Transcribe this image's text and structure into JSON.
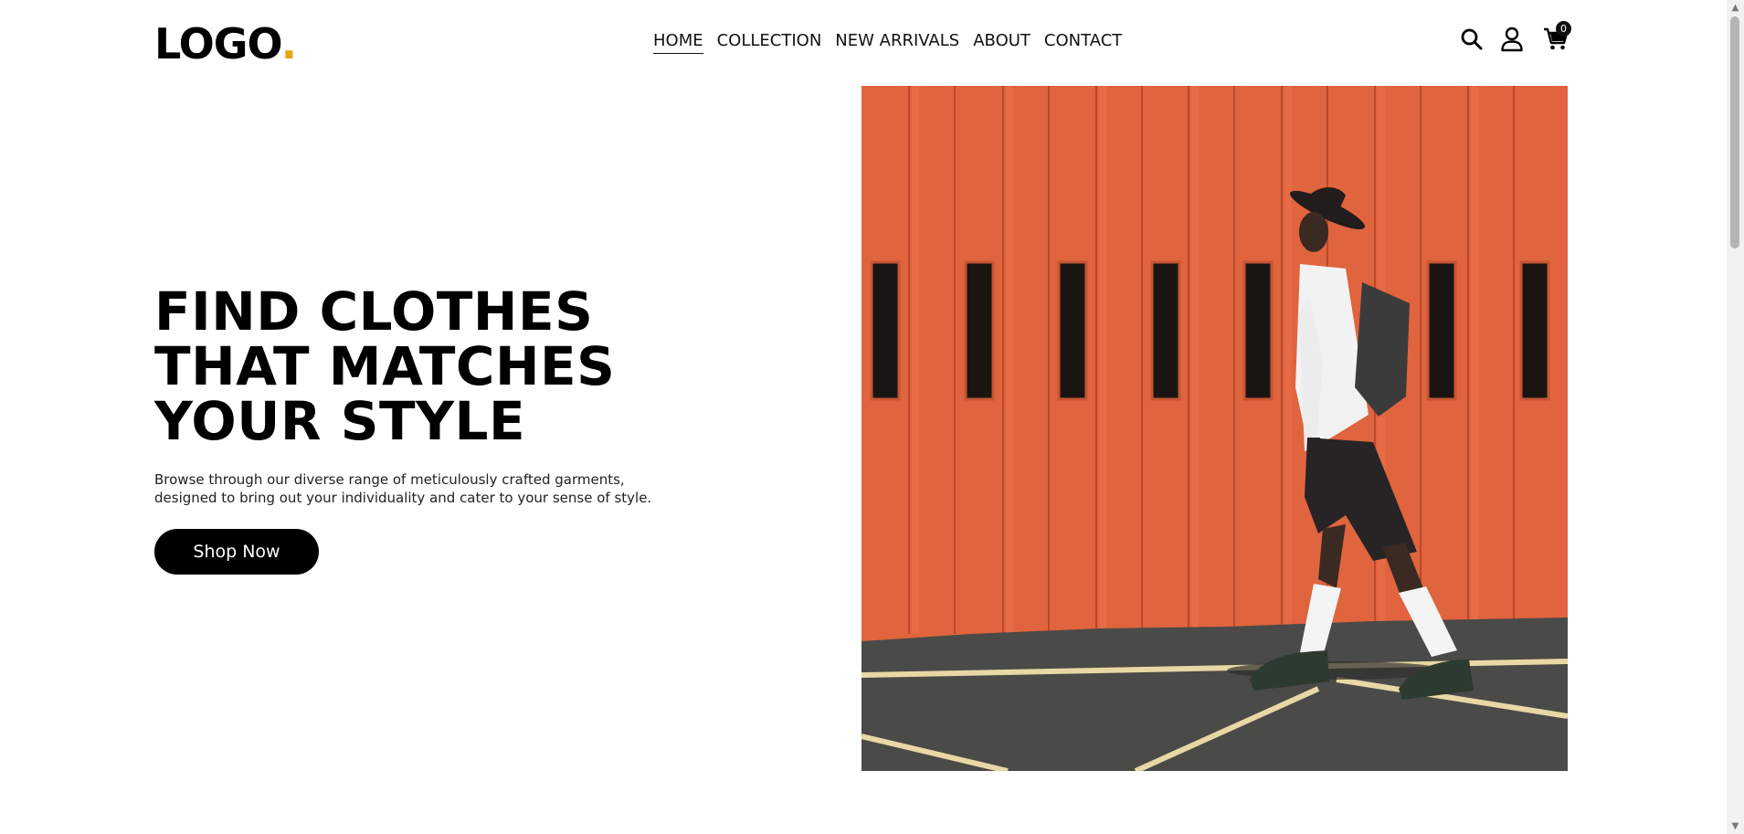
{
  "header": {
    "logo_text": "LOGO",
    "logo_dot": ".",
    "nav": [
      {
        "label": "HOME",
        "active": true
      },
      {
        "label": "COLLECTION"
      },
      {
        "label": "NEW ARRIVALS"
      },
      {
        "label": "ABOUT"
      },
      {
        "label": "CONTACT"
      }
    ],
    "cart_count": "0",
    "icons": [
      "search-icon",
      "user-icon",
      "cart-icon"
    ]
  },
  "hero": {
    "title_lines": [
      "FIND CLOTHES",
      "THAT MATCHES",
      "YOUR STYLE"
    ],
    "description_lines": [
      "Browse through our diverse range of meticulously crafted garments,",
      "designed to bring out your individuality and cater to your sense of style."
    ],
    "cta_label": "Shop Now"
  },
  "colors": {
    "accent": "#e8a317",
    "text": "#000000",
    "button_bg": "#000000",
    "wall": "#e0643e",
    "pavement": "#4a4a48"
  }
}
